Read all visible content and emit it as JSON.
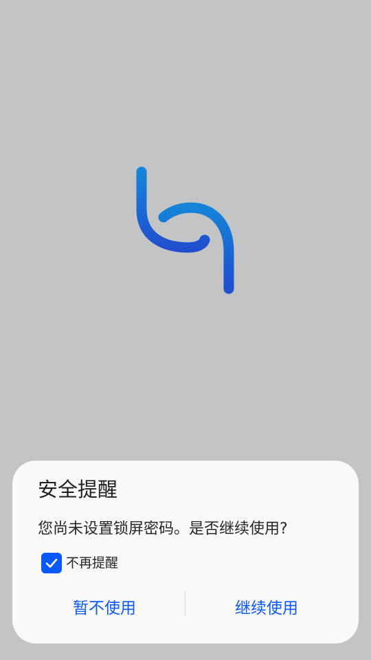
{
  "colors": {
    "background": "#c3c4c6",
    "dialog_background": "#f9f9f9",
    "accent": "#0a59f7",
    "logo_gradient_top": "#1583d8",
    "logo_gradient_bottom": "#1f4fce"
  },
  "logo": {
    "icon": "harmony-h-logo-icon"
  },
  "dialog": {
    "title": "安全提醒",
    "message": "您尚未设置锁屏密码。是否继续使用?",
    "checkbox": {
      "label": "不再提醒",
      "checked": true
    },
    "buttons": {
      "cancel": "暂不使用",
      "confirm": "继续使用"
    }
  }
}
